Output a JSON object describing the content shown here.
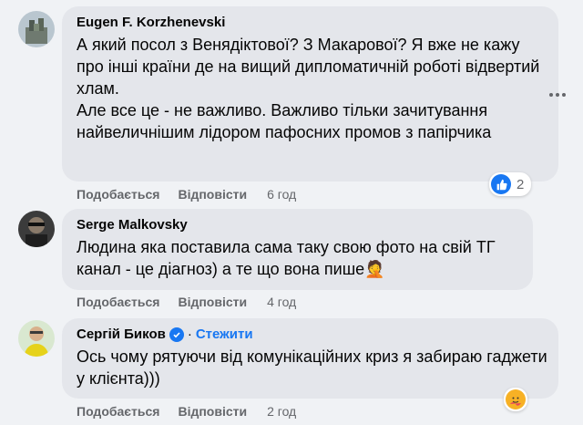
{
  "comments": [
    {
      "author": "Eugen F. Korzhenevski",
      "text": "А який посол з Венядіктової? З Макарової? Я вже не кажу про інші країни де на вищий дипломатичній роботі відвертий хлам.\nАле все це - не важливо. Важливо тільки зачитування найвеличнішим лідором пафосних промов з папірчика",
      "like_label": "Подобається",
      "reply_label": "Відповісти",
      "time": "6 год",
      "reaction": {
        "icon": "like-icon",
        "count": "2"
      }
    },
    {
      "author": "Serge Malkovsky",
      "text": "Людина яка поставила сама таку свою фото на свій ТГ канал - це діагноз) а те що вона пише🤦",
      "like_label": "Подобається",
      "reply_label": "Відповісти",
      "time": "4 год"
    },
    {
      "author": "Сергій Биков",
      "separator": "·",
      "follow_label": "Стежити",
      "text": "Ось чому рятуючи від комунікаційних криз я забираю гаджети у клієнта)))",
      "like_label": "Подобається",
      "reply_label": "Відповісти",
      "time": "2 год",
      "reaction": {
        "icon": "care-icon"
      }
    }
  ],
  "colors": {
    "background": "#f0f2f5",
    "bubble": "#e4e6eb",
    "accent": "#1877f2",
    "meta": "#65676b"
  }
}
